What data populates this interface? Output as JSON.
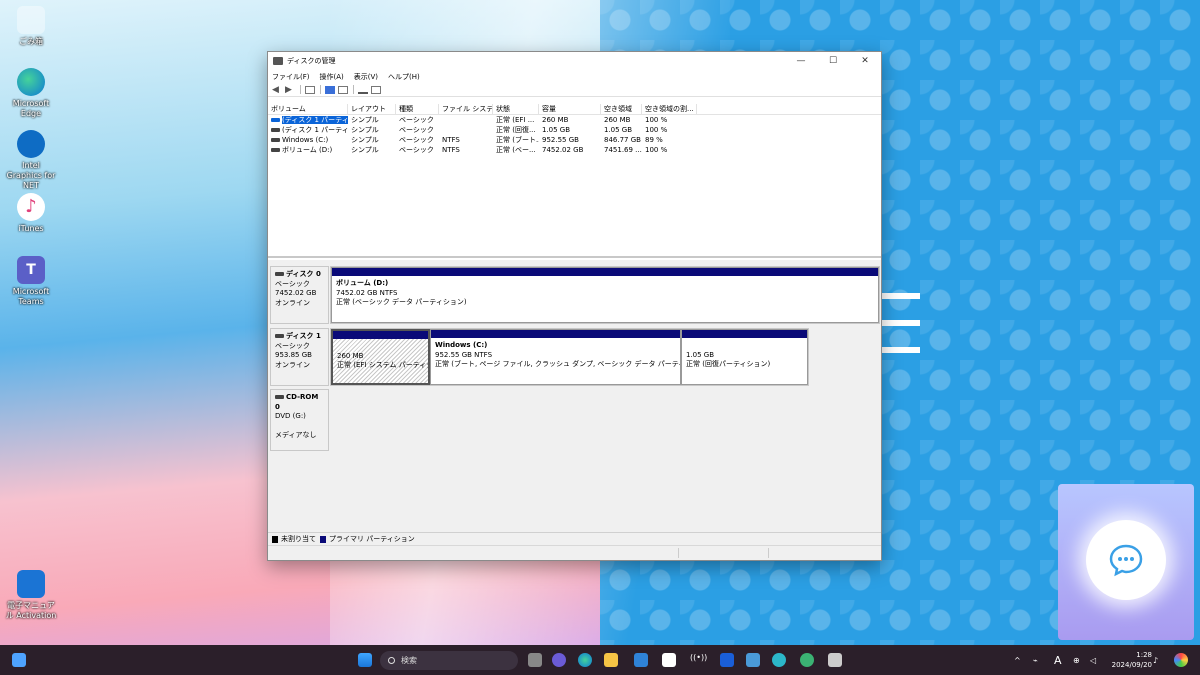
{
  "desktop": {
    "icons": [
      {
        "label": "ごみ箱",
        "name": "recycle-bin"
      },
      {
        "label": "Microsoft Edge",
        "name": "edge"
      },
      {
        "label": "Intel Graphics for NET",
        "name": "intel"
      },
      {
        "label": "iTunes",
        "name": "itunes"
      },
      {
        "label": "Microsoft Teams",
        "name": "teams"
      },
      {
        "label": "電子マニュアル Activation",
        "name": "manual"
      }
    ]
  },
  "window": {
    "title": "ディスクの管理",
    "menu": [
      "ファイル(F)",
      "操作(A)",
      "表示(V)",
      "ヘルプ(H)"
    ],
    "list": {
      "headers": [
        "ボリューム",
        "レイアウト",
        "種類",
        "ファイル システム",
        "状態",
        "容量",
        "空き領域",
        "空き領域の割..."
      ],
      "rows": [
        [
          "(ディスク 1 パーティシ...",
          "シンプル",
          "ベーシック",
          "",
          "正常 (EFI ...",
          "260 MB",
          "260 MB",
          "100 %"
        ],
        [
          "(ディスク 1 パーティシ...",
          "シンプル",
          "ベーシック",
          "",
          "正常 (回復...",
          "1.05 GB",
          "1.05 GB",
          "100 %"
        ],
        [
          "Windows (C:)",
          "シンプル",
          "ベーシック",
          "NTFS",
          "正常 (ブート...",
          "952.55 GB",
          "846.77 GB",
          "89 %"
        ],
        [
          "ボリューム (D:)",
          "シンプル",
          "ベーシック",
          "NTFS",
          "正常 (ベー...",
          "7452.02 GB",
          "7451.69 ...",
          "100 %"
        ]
      ]
    },
    "disks": {
      "disk0": {
        "name": "ディスク 0",
        "type": "ベーシック",
        "size": "7452.02 GB",
        "status": "オンライン",
        "part": {
          "name": "ボリューム (D:)",
          "size": "7452.02 GB NTFS",
          "status": "正常 (ベーシック データ パーティション)"
        }
      },
      "disk1": {
        "name": "ディスク 1",
        "type": "ベーシック",
        "size": "953.85 GB",
        "status": "オンライン",
        "p1": {
          "size": "260 MB",
          "status": "正常 (EFI システム パーティション)"
        },
        "p2": {
          "name": "Windows (C:)",
          "size": "952.55 GB NTFS",
          "status": "正常 (ブート, ページ ファイル, クラッシュ ダンプ, ベーシック データ パーティション)"
        },
        "p3": {
          "size": "1.05 GB",
          "status": "正常 (回復パーティション)"
        }
      },
      "cdrom": {
        "name": "CD-ROM 0",
        "type": "DVD (G:)",
        "status": "メディアなし"
      }
    },
    "legend": {
      "unalloc": "未割り当て",
      "primary": "プライマリ パーティション",
      "unalloc_color": "#000000",
      "primary_color": "#0a0a78"
    }
  },
  "taskbar": {
    "search_placeholder": "検索",
    "time": "1:28",
    "date": "2024/09/20",
    "ime": "A"
  }
}
